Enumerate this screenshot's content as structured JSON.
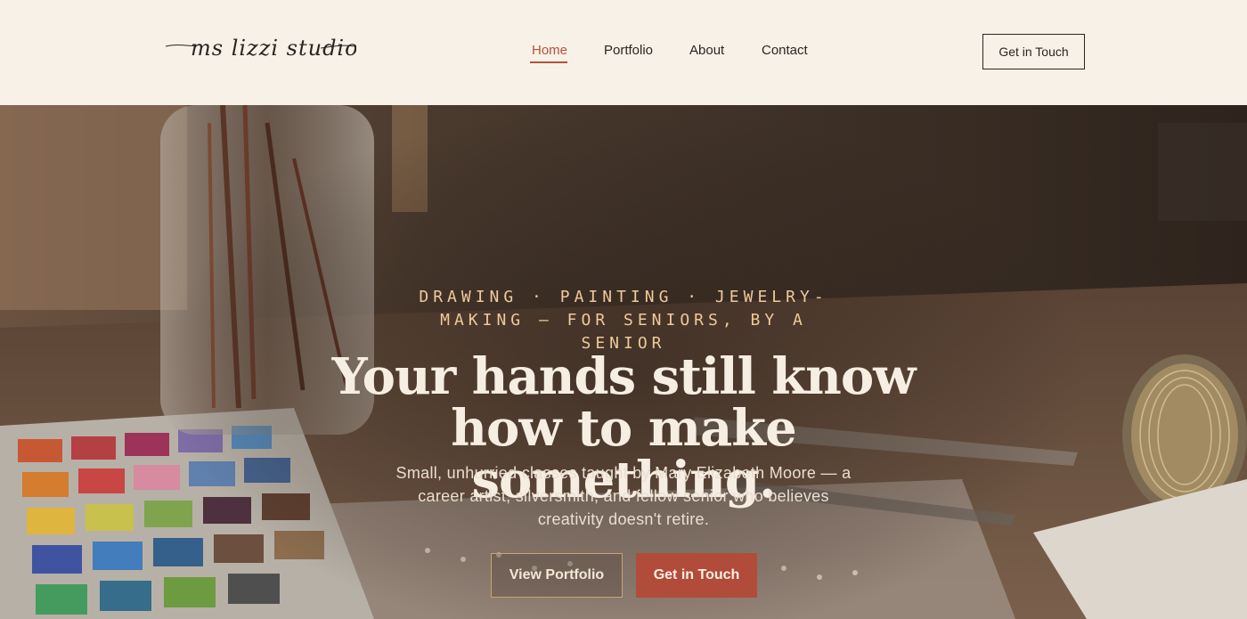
{
  "header": {
    "logo_text": "ms lizzi studio",
    "nav": [
      {
        "label": "Home",
        "active": true
      },
      {
        "label": "Portfolio",
        "active": false
      },
      {
        "label": "About",
        "active": false
      },
      {
        "label": "Contact",
        "active": false
      }
    ],
    "cta_label": "Get in Touch"
  },
  "hero": {
    "eyebrow": "Drawing · Painting · Jewelry-Making — for seniors, by a senior",
    "title": "Your hands still know how to make something.",
    "subtitle": "Small, unhurried classes taught by Mary Elizabeth Moore — a career artist, silversmith, and fellow senior who believes creativity doesn't retire.",
    "primary_button": "View Portfolio",
    "secondary_button": "Get in Touch"
  },
  "colors": {
    "page_bg": "#f8f1e7",
    "accent": "#b14c3a",
    "text_dark": "#2a2522",
    "eyebrow": "#efc99a"
  }
}
